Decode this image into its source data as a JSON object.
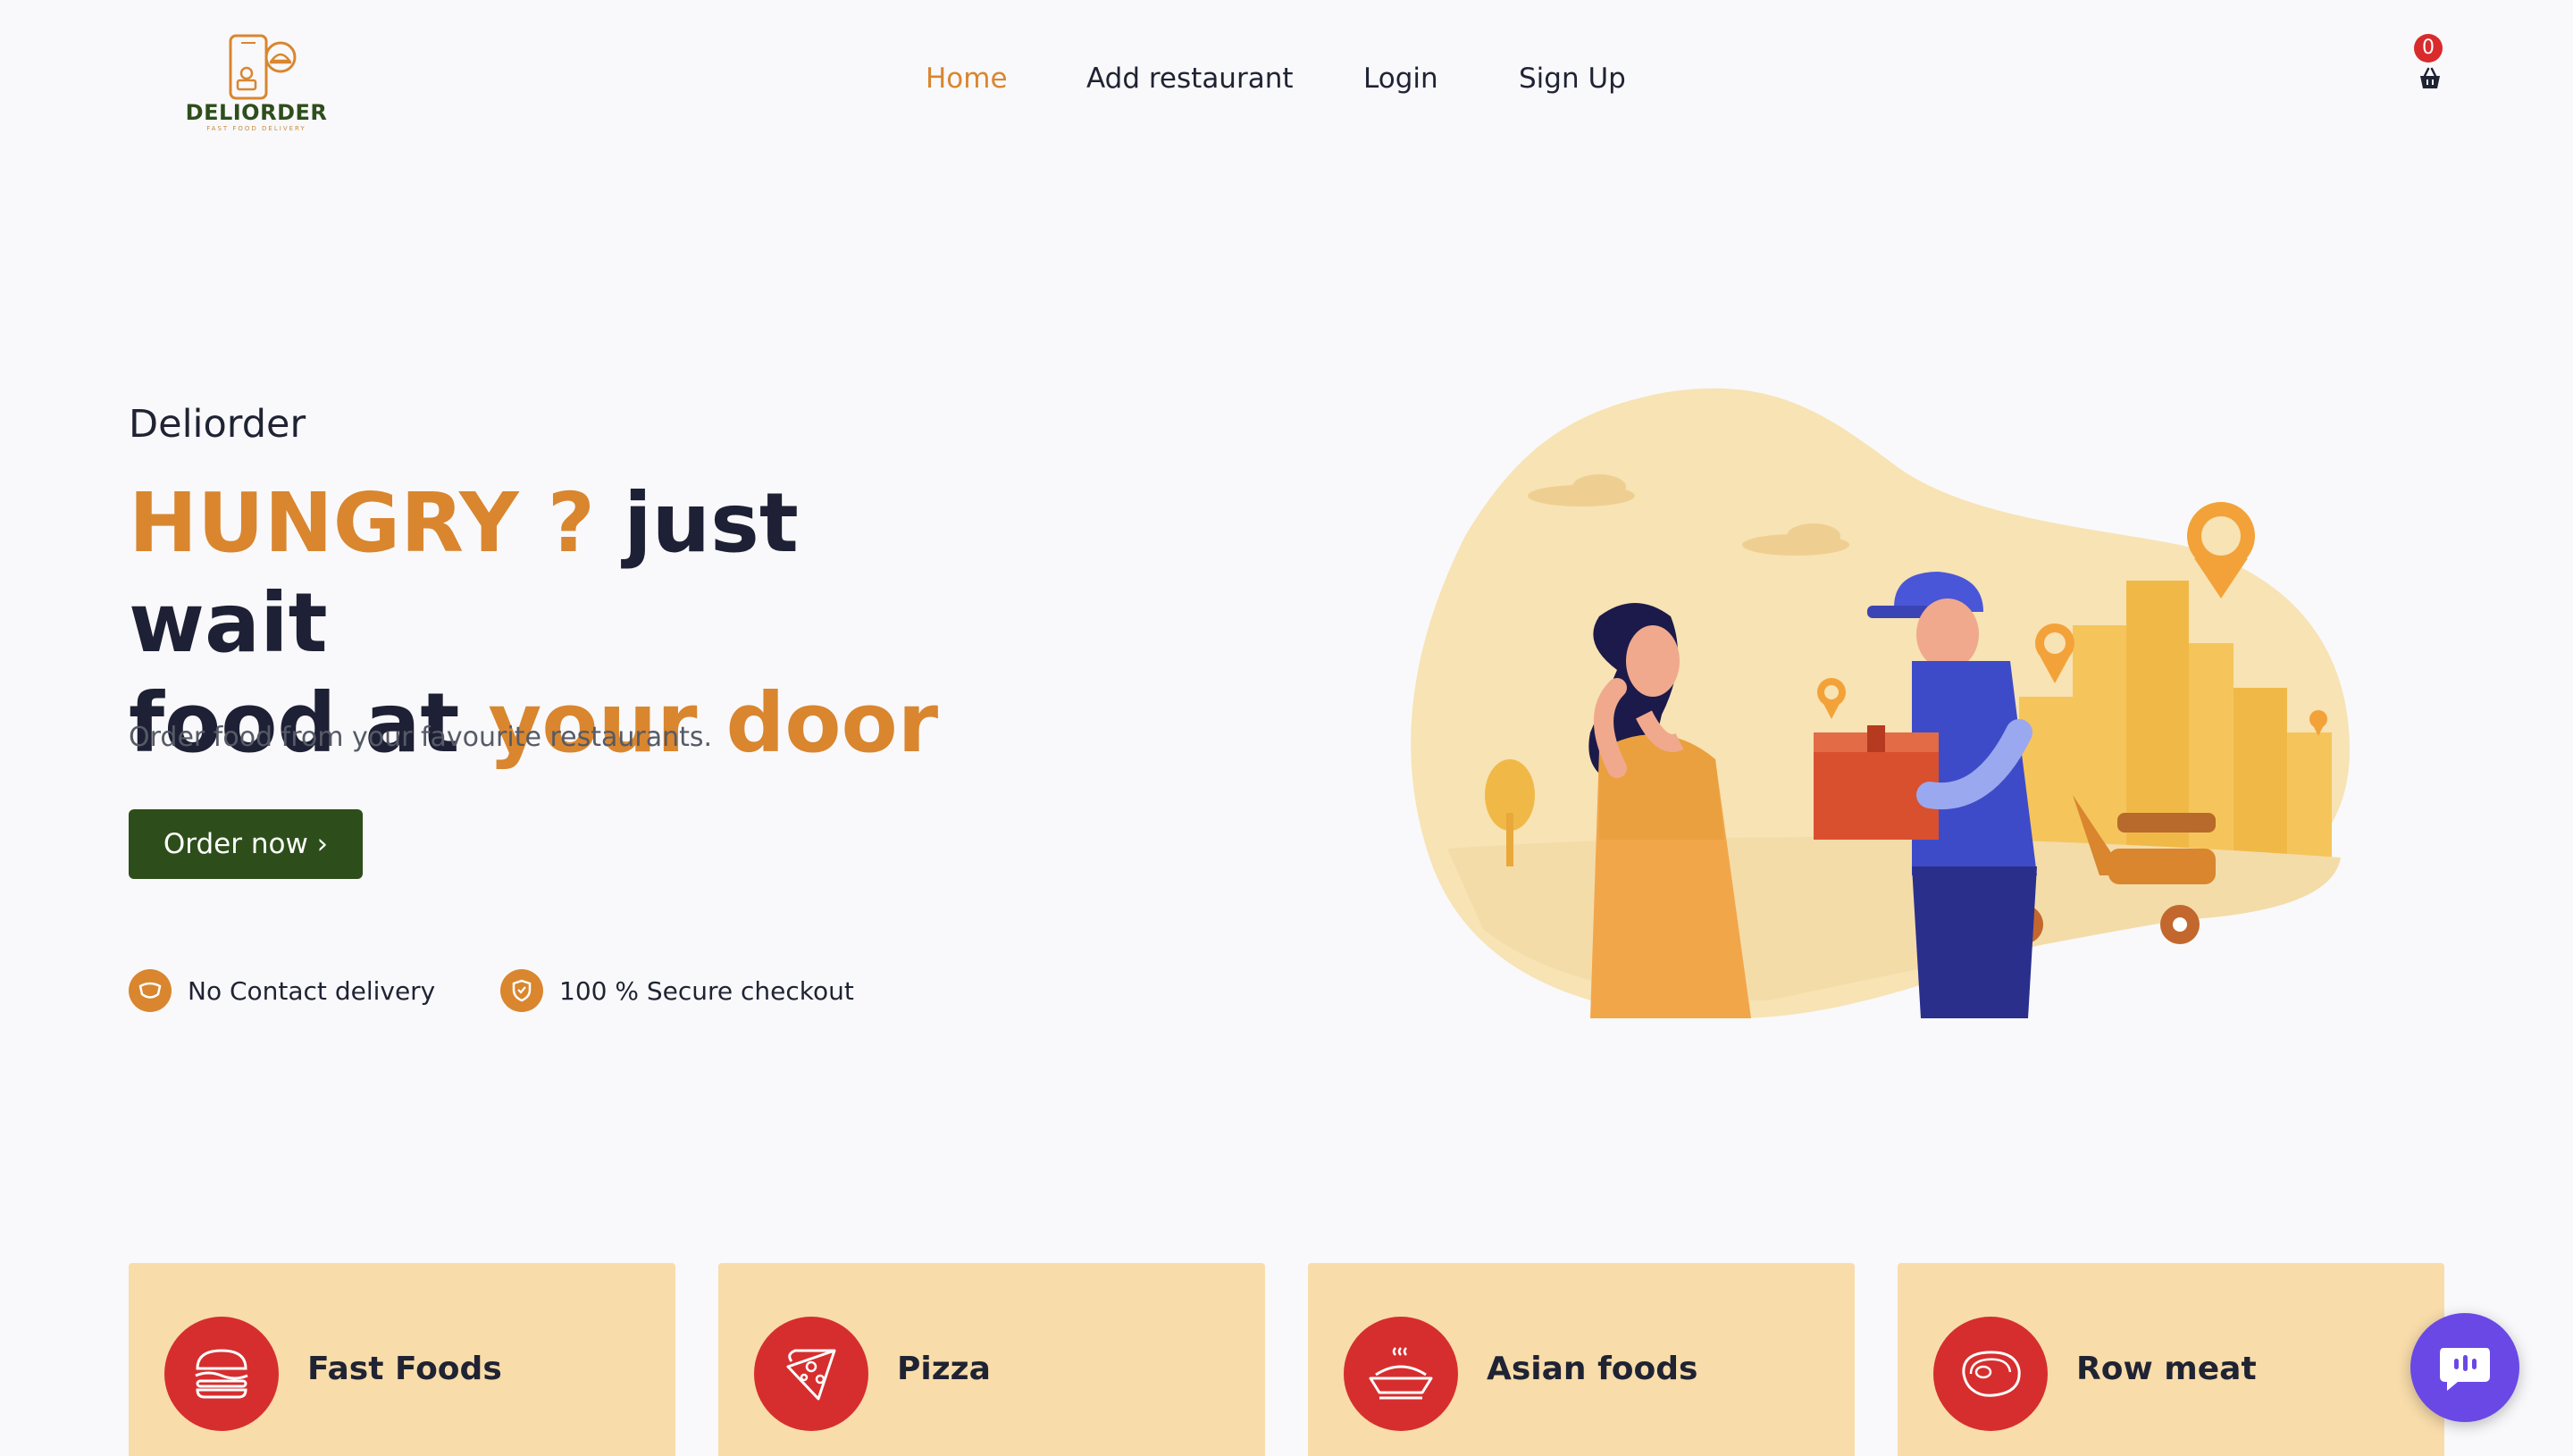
{
  "header": {
    "logo": {
      "name": "DELIORDER",
      "tagline": "FAST FOOD DELIVERY"
    },
    "nav": [
      {
        "label": "Home",
        "active": true
      },
      {
        "label": "Add restaurant",
        "active": false
      },
      {
        "label": "Login",
        "active": false
      },
      {
        "label": "Sign Up",
        "active": false
      }
    ],
    "cart": {
      "count": "0",
      "icon": "basket-icon"
    }
  },
  "hero": {
    "brand": "Deliorder",
    "headline": {
      "part1": "HUNGRY ?",
      "part2": " just wait",
      "part3": "food at ",
      "part4": "your door"
    },
    "subtext": "Order food from your favourite restaurants.",
    "cta_label": "Order now ›",
    "features": [
      {
        "label": "No Contact delivery",
        "icon": "mask-icon"
      },
      {
        "label": "100 % Secure checkout",
        "icon": "shield-icon"
      }
    ]
  },
  "categories": [
    {
      "label": "Fast Foods",
      "icon": "burger-icon"
    },
    {
      "label": "Pizza",
      "icon": "pizza-icon"
    },
    {
      "label": "Asian foods",
      "icon": "asian-food-icon"
    },
    {
      "label": "Row meat",
      "icon": "meat-icon"
    }
  ],
  "colors": {
    "accent": "#d9862f",
    "dark_green": "#2d4e1a",
    "category_bg": "#f8dcaa",
    "category_icon_bg": "#d62e2e",
    "badge": "#d92b2b",
    "chat": "#6a48e6"
  }
}
